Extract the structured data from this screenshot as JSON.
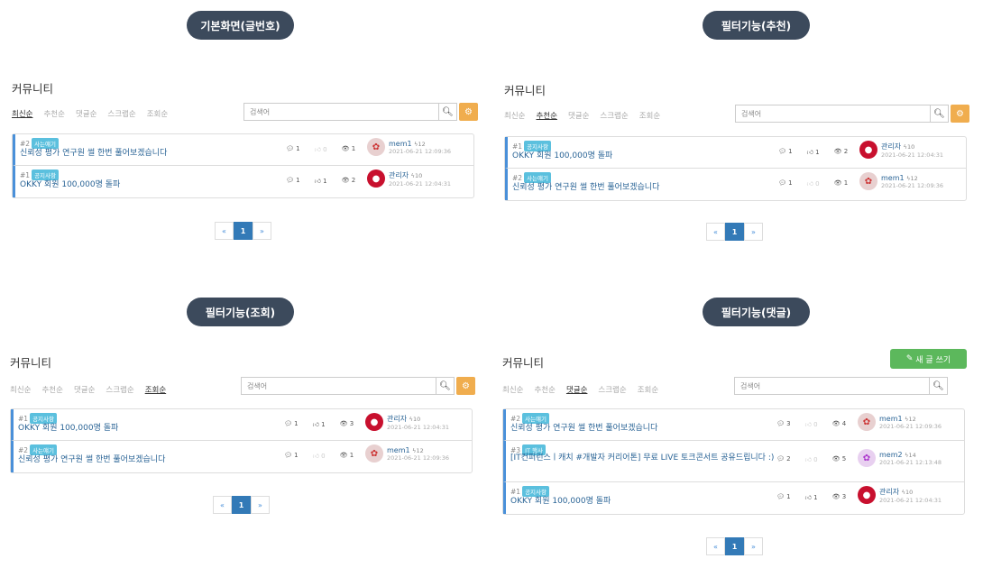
{
  "captions": [
    "기본화면(글번호)",
    "필터기능(추천)",
    "필터기능(조회)",
    "필터기능(댓글)"
  ],
  "community_title": "커뮤니티",
  "sorts": [
    "최신순",
    "추천순",
    "댓글순",
    "스크랩순",
    "조회순"
  ],
  "search_placeholder": "검색어",
  "new_post_label": "새 글 쓰기",
  "pager": {
    "prev": "«",
    "current": "1",
    "next": "»"
  },
  "posts": {
    "survey": {
      "num": "#2",
      "badge": "사는얘기",
      "title": "신뢰성 평가 연구원 썰 한번 풀어보겠습니다",
      "user": "mem1",
      "level": "12",
      "date": "2021-06-21 12:09:36"
    },
    "okky": {
      "num": "#1",
      "badge": "공지사항",
      "title": "OKKY 회원 100,000명 돌파",
      "user": "관리자",
      "level": "10",
      "date": "2021-06-21 12:04:31"
    },
    "it": {
      "num": "#3",
      "badge": "IT 행사",
      "title": "[IT컨퍼런스ㅣ캐치 #개발자 커리어톤] 무료 LIVE 토크콘서트 공유드립니다 :)",
      "user": "mem2",
      "level": "14",
      "date": "2021-06-21 12:13:48"
    }
  },
  "panels": [
    {
      "active_sort": 0,
      "rows": [
        {
          "post": "survey",
          "comments": "1",
          "likes": "0",
          "views": "1"
        },
        {
          "post": "okky",
          "comments": "1",
          "likes": "1",
          "views": "2"
        }
      ]
    },
    {
      "active_sort": 1,
      "rows": [
        {
          "post": "okky",
          "comments": "1",
          "likes": "1",
          "views": "2"
        },
        {
          "post": "survey",
          "comments": "1",
          "likes": "0",
          "views": "1"
        }
      ]
    },
    {
      "active_sort": 4,
      "rows": [
        {
          "post": "okky",
          "comments": "1",
          "likes": "1",
          "views": "3"
        },
        {
          "post": "survey",
          "comments": "1",
          "likes": "0",
          "views": "1"
        }
      ]
    },
    {
      "active_sort": 2,
      "rows": [
        {
          "post": "survey",
          "comments": "3",
          "likes": "0",
          "views": "4"
        },
        {
          "post": "it",
          "comments": "2",
          "likes": "0",
          "views": "5"
        },
        {
          "post": "okky",
          "comments": "1",
          "likes": "1",
          "views": "3"
        }
      ]
    }
  ]
}
